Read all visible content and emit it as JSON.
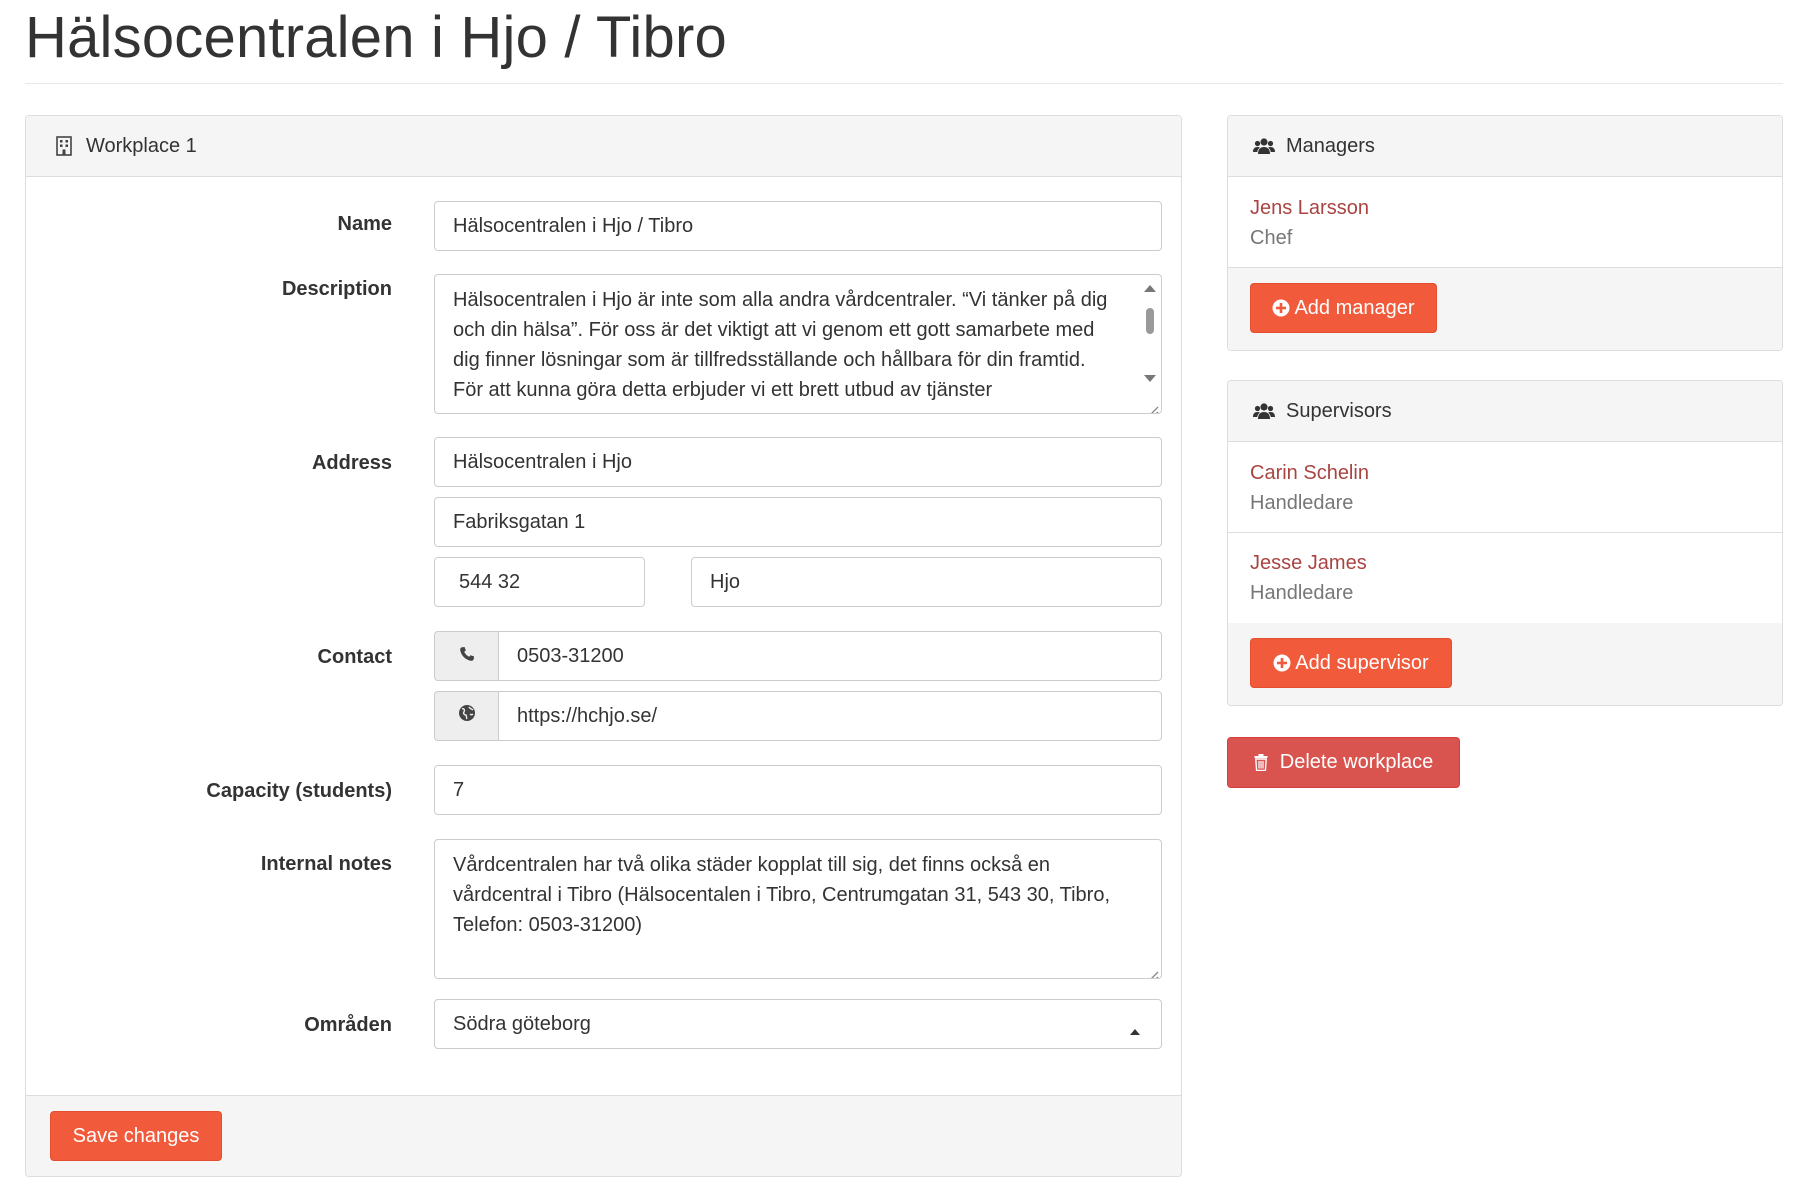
{
  "page": {
    "title": "Hälsocentralen i Hjo / Tibro"
  },
  "workplace": {
    "heading": "Workplace 1",
    "labels": {
      "name": "Name",
      "description": "Description",
      "address": "Address",
      "contact": "Contact",
      "capacity": "Capacity (students)",
      "notes": "Internal notes",
      "areas": "Områden"
    },
    "name": "Hälsocentralen i Hjo / Tibro",
    "description": "Hälsocentralen i Hjo är inte som alla andra vårdcentraler. “Vi tänker på dig och din hälsa”. För oss är det viktigt att vi genom ett gott samarbete med dig finner lösningar som är tillfredsställande och hållbara för din framtid. För att kunna göra detta erbjuder vi ett brett utbud av tjänster",
    "address_line1": "Hälsocentralen i Hjo",
    "address_line2": "Fabriksgatan 1",
    "postal_code": "544 32",
    "city": "Hjo",
    "phone": "0503-31200",
    "website": "https://hchjo.se/",
    "capacity": "7",
    "notes": "Vårdcentralen har två olika städer kopplat till sig, det finns också en vårdcentral i Tibro (Hälsocentalen i Tibro, Centrumgatan 31, 543 30, Tibro, Telefon: 0503-31200)",
    "area_selected": "Södra göteborg",
    "save_label": "Save changes"
  },
  "managers": {
    "heading": "Managers",
    "items": [
      {
        "name": "Jens Larsson",
        "role": "Chef"
      }
    ],
    "add_label": "Add manager"
  },
  "supervisors": {
    "heading": "Supervisors",
    "items": [
      {
        "name": "Carin Schelin",
        "role": "Handledare"
      },
      {
        "name": "Jesse James",
        "role": "Handledare"
      }
    ],
    "add_label": "Add supervisor"
  },
  "delete_label": "Delete workplace",
  "colors": {
    "primary_orange": "#f15a3a",
    "danger_red": "#d9534f",
    "link_red": "#a94442"
  },
  "icons": [
    "building-icon",
    "users-icon",
    "phone-icon",
    "globe-icon",
    "plus-circle-icon",
    "trash-icon",
    "caret-up-icon"
  ]
}
